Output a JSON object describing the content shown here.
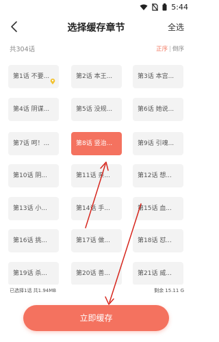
{
  "status_bar": {
    "time": "5:44",
    "icons": [
      "wifi-icon",
      "sim-off-icon",
      "battery-icon"
    ]
  },
  "header": {
    "title": "选择缓存章节",
    "back_icon": "chevron-left-icon",
    "select_all": "全选"
  },
  "meta": {
    "total": "共304话",
    "order_asc": "正序",
    "order_sep": "|",
    "order_desc": "倒序"
  },
  "chapters": [
    "第1话 不要...",
    "第2话 本王...",
    "第3话 本宫...",
    "第4话 阴谋...",
    "第5话 没规...",
    "第6话 她说...",
    "第7话 呵！...",
    "第8话 竖治...",
    "第9话 引魂...",
    "第10话 阴...",
    "第11话 亲...",
    "第12话 想...",
    "第13话 小...",
    "第14话 手...",
    "第15话 血...",
    "第16话 挑...",
    "第17话 做...",
    "第18话 怼...",
    "第19话 杀...",
    "第20话 善...",
    "第21话 威..."
  ],
  "selected_chapter_index": 7,
  "footer": {
    "selected_info": "已选择1话 共1.94MB",
    "remaining": "剩余 15.11 G"
  },
  "action": {
    "cache_button": "立即缓存"
  },
  "colors": {
    "accent": "#f4725f",
    "tile_bg": "#f3f3f3",
    "annotation_red": "#d6251c"
  }
}
